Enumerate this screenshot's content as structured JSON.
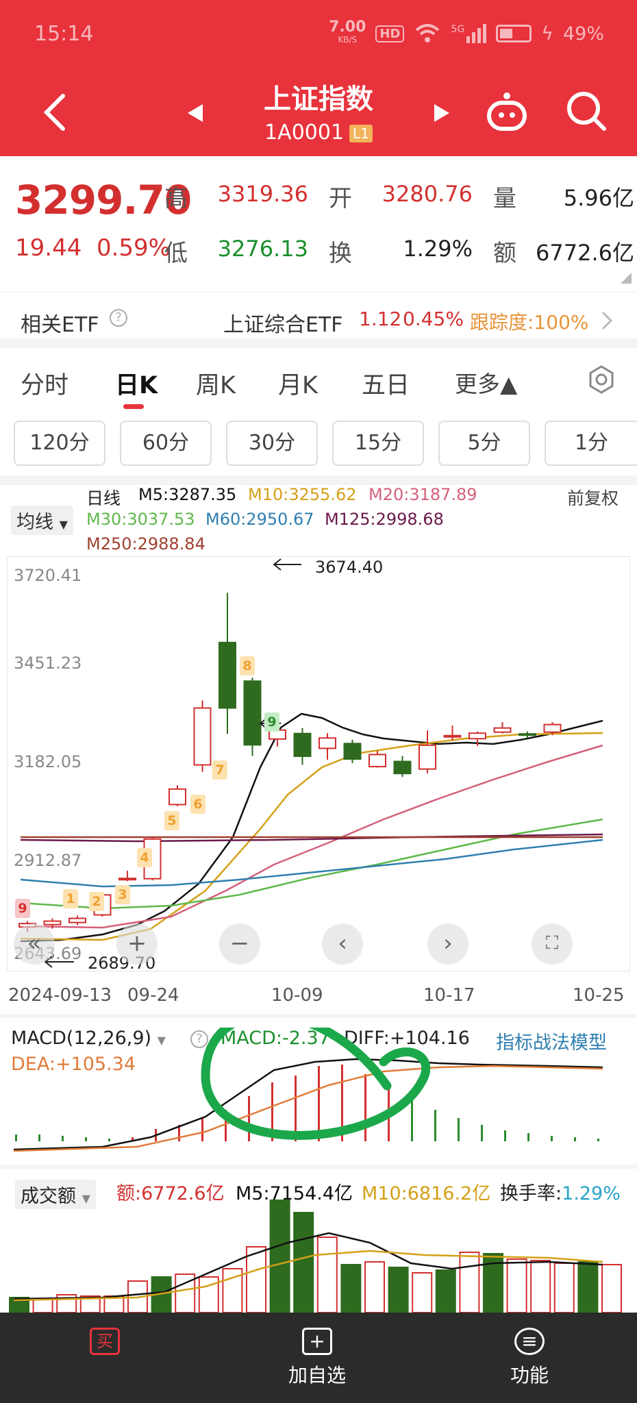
{
  "status": {
    "time": "15:14",
    "speed": "7.00",
    "speed_unit": "KB/S",
    "hd": "HD",
    "network": "5G",
    "battery": "49%"
  },
  "header": {
    "title": "上证指数",
    "code": "1A0001",
    "level_badge": "L1"
  },
  "quote": {
    "price": "3299.70",
    "change": "19.44",
    "change_pct": "0.59%",
    "high_label": "高",
    "high": "3319.36",
    "open_label": "开",
    "open": "3280.76",
    "vol_label": "量",
    "vol": "5.96亿",
    "low_label": "低",
    "low": "3276.13",
    "turnover_label": "换",
    "turnover": "1.29%",
    "amount_label": "额",
    "amount": "6772.6亿"
  },
  "etf": {
    "label": "相关ETF",
    "name": "上证综合ETF",
    "price": "1.12",
    "pct": "0.45%",
    "track": "跟踪度:100%"
  },
  "tabs": [
    "分时",
    "日K",
    "周K",
    "月K",
    "五日",
    "更多▲"
  ],
  "periods": [
    "120分",
    "60分",
    "30分",
    "15分",
    "5分",
    "1分"
  ],
  "kline": {
    "ma_dropdown": "均线",
    "period_label": "日线",
    "fq": "前复权",
    "m5": "M5:3287.35",
    "m10": "M10:3255.62",
    "m20": "M20:3187.89",
    "m30": "M30:3037.53",
    "m60": "M60:2950.67",
    "m125": "M125:2998.68",
    "m250": "M250:2988.84",
    "max_label": "3674.40",
    "min_label": "2689.70",
    "y_ticks": [
      "3720.41",
      "3451.23",
      "3182.05",
      "2912.87",
      "2643.69"
    ],
    "x_ticks": [
      "2024-09-13",
      "09-24",
      "10-09",
      "10-17",
      "10-25"
    ],
    "seq": [
      "9",
      "1",
      "2",
      "3",
      "4",
      "5",
      "6",
      "7",
      "8",
      "9"
    ]
  },
  "macd": {
    "dropdown": "MACD(12,26,9)",
    "macd": "MACD:-2.37",
    "diff": "DIFF:+104.16",
    "dea": "DEA:+105.34",
    "link": "指标战法模型"
  },
  "volume": {
    "dropdown": "成交额",
    "amount": "额:6772.6亿",
    "m5": "M5:7154.4亿",
    "m10": "M10:6816.2亿",
    "turnover_label": "换手率:",
    "turnover": "1.29%"
  },
  "nav": {
    "buy": "买",
    "add": "加自选",
    "func": "功能"
  },
  "colors": {
    "up": "#d32f2f",
    "down": "#2e6b1f",
    "header": "#e8323c",
    "ma5": "#111111",
    "ma10": "#d4a017",
    "ma20": "#d4607a",
    "ma30": "#5fb84a",
    "ma60": "#2f7fb0",
    "ma125": "#6a1a4a",
    "ma250": "#a04030",
    "highlight": "#1aa84a"
  },
  "chart_data": {
    "type": "candlestick",
    "y_range": [
      2643.69,
      3720.41
    ],
    "x_labels": [
      "2024-09-13",
      "09-24",
      "10-09",
      "10-17",
      "10-25"
    ],
    "high": "3674.40",
    "low": "2689.70",
    "candles": [
      {
        "o": 2705,
        "c": 2715,
        "h": 2722,
        "l": 2690
      },
      {
        "o": 2712,
        "c": 2722,
        "h": 2730,
        "l": 2700
      },
      {
        "o": 2718,
        "c": 2730,
        "h": 2738,
        "l": 2710
      },
      {
        "o": 2740,
        "c": 2798,
        "h": 2805,
        "l": 2735
      },
      {
        "o": 2842,
        "c": 2846,
        "h": 2868,
        "l": 2838
      },
      {
        "o": 2845,
        "c": 2960,
        "h": 2966,
        "l": 2840
      },
      {
        "o": 3060,
        "c": 3105,
        "h": 3116,
        "l": 3055
      },
      {
        "o": 3175,
        "c": 3340,
        "h": 3362,
        "l": 3155
      },
      {
        "o": 3530,
        "c": 3340,
        "h": 3674,
        "l": 3265
      },
      {
        "o": 3418,
        "c": 3233,
        "h": 3428,
        "l": 3201
      },
      {
        "o": 3250,
        "c": 3276,
        "h": 3307,
        "l": 3228
      },
      {
        "o": 3266,
        "c": 3200,
        "h": 3282,
        "l": 3175
      },
      {
        "o": 3223,
        "c": 3253,
        "h": 3267,
        "l": 3190
      },
      {
        "o": 3237,
        "c": 3192,
        "h": 3248,
        "l": 3180
      },
      {
        "o": 3170,
        "c": 3205,
        "h": 3216,
        "l": 3167
      },
      {
        "o": 3185,
        "c": 3150,
        "h": 3201,
        "l": 3140
      },
      {
        "o": 3163,
        "c": 3232,
        "h": 3275,
        "l": 3150
      },
      {
        "o": 3259,
        "c": 3260,
        "h": 3289,
        "l": 3246
      },
      {
        "o": 3251,
        "c": 3267,
        "h": 3272,
        "l": 3230
      },
      {
        "o": 3270,
        "c": 3282,
        "h": 3299,
        "l": 3266
      },
      {
        "o": 3265,
        "c": 3264,
        "h": 3272,
        "l": 3253
      },
      {
        "o": 3270,
        "c": 3292,
        "h": 3299,
        "l": 3261
      }
    ]
  }
}
